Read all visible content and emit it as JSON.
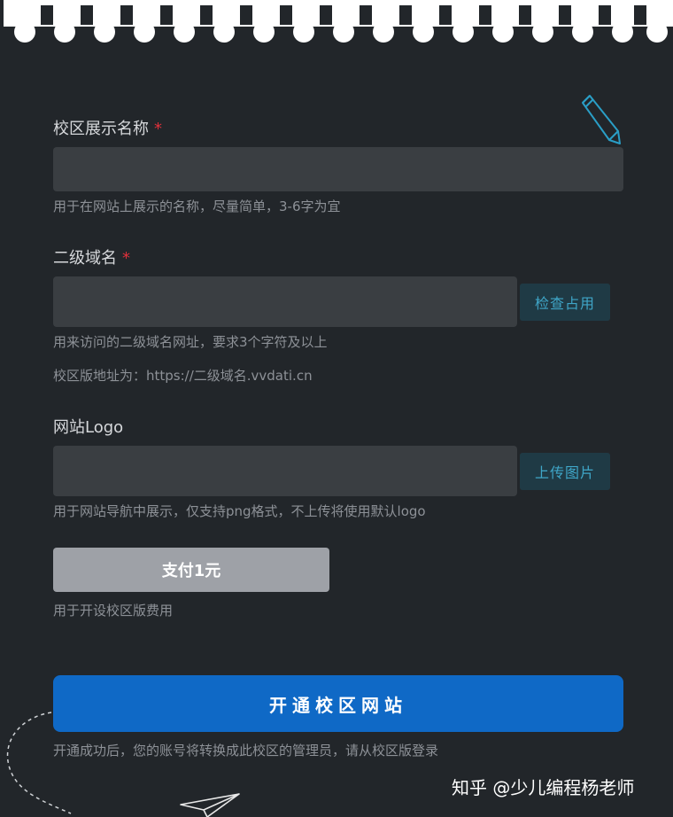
{
  "colors": {
    "background": "#22262a",
    "input_bg": "#3a3e42",
    "required_star": "#e0313b",
    "side_button_text": "#3fa6c8",
    "pay_button_bg": "#9ea1a7",
    "primary_button_bg": "#0f69c6"
  },
  "icons": [
    "pencil-icon",
    "paper-plane-icon"
  ],
  "form": {
    "campus_name": {
      "label": "校区展示名称",
      "required_mark": "*",
      "value": "",
      "hint": "用于在网站上展示的名称，尽量简单，3-6字为宜"
    },
    "subdomain": {
      "label": "二级域名",
      "required_mark": "*",
      "value": "",
      "button": "检查占用",
      "hint": "用来访问的二级域名网址，要求3个字符及以上",
      "address_hint": "校区版地址为：https://二级域名.vvdati.cn"
    },
    "logo": {
      "label": "网站Logo",
      "value": "",
      "button": "上传图片",
      "hint": "用于网站导航中展示，仅支持png格式，不上传将使用默认logo"
    },
    "payment": {
      "button": "支付1元",
      "hint": "用于开设校区版费用"
    },
    "submit": {
      "button": "开通校区网站",
      "hint": "开通成功后，您的账号将转换成此校区的管理员，请从校区版登录"
    }
  },
  "watermark": "知乎 @少儿编程杨老师"
}
